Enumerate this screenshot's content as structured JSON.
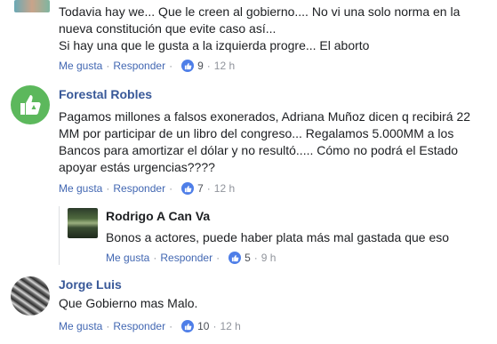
{
  "actions": {
    "like": "Me gusta",
    "reply": "Responder",
    "dot": "·"
  },
  "comments": [
    {
      "lines": [
        "Todavia hay we... Que le creen al gobierno.... No vi una solo norma en la",
        "nueva constitución que evite caso así...",
        "Si hay una que le gusta a la izquierda progre... El aborto"
      ],
      "likes": "9",
      "time": "12 h"
    },
    {
      "author": "Forestal Robles",
      "lines": [
        "Pagamos millones a falsos exonerados, Adriana Muñoz dicen q recibirá 22",
        "MM por participar de un libro del congreso... Regalamos 5.000MM a los",
        "Bancos para amortizar el dólar y no resultó..... Cómo no podrá el Estado",
        "apoyar estás urgencias????"
      ],
      "likes": "7",
      "time": "12 h"
    },
    {
      "author": "Rodrigo A Can Va",
      "lines": [
        "Bonos a actores, puede haber plata más mal gastada que eso"
      ],
      "likes": "5",
      "time": "9 h"
    },
    {
      "author": "Jorge Luis",
      "lines": [
        "Que Gobierno mas Malo."
      ],
      "likes": "10",
      "time": "12 h"
    }
  ],
  "colors": {
    "link": "#4267b2",
    "name": "#385898",
    "like": "#4e7ee8",
    "avatar_green": "#5cb85c"
  },
  "icons": {
    "like": "thumbs-up-icon"
  }
}
